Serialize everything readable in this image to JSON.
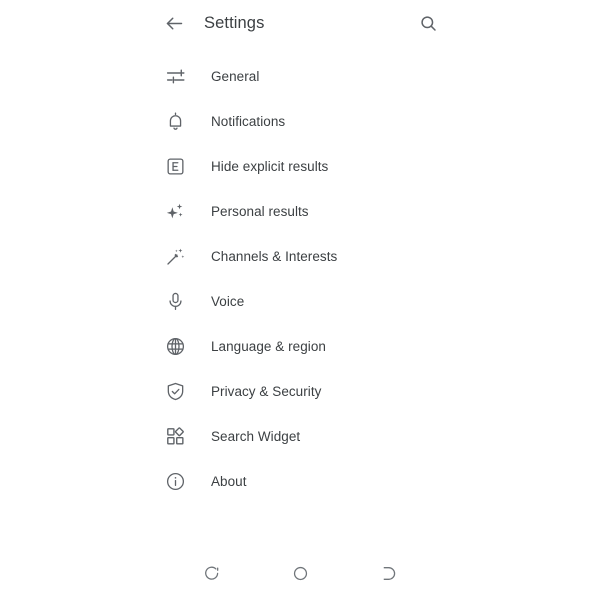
{
  "appbar": {
    "back_icon": "arrow-back-icon",
    "title": "Settings",
    "search_icon": "search-icon"
  },
  "colors": {
    "background": "#ffffff",
    "text": "#3c4043",
    "icon": "#5f6368",
    "nav_icon": "#70757a"
  },
  "settings": {
    "items": [
      {
        "label": "General",
        "icon": "tune-icon"
      },
      {
        "label": "Notifications",
        "icon": "bell-icon"
      },
      {
        "label": "Hide explicit results",
        "icon": "explicit-icon"
      },
      {
        "label": "Personal results",
        "icon": "sparkle-icon"
      },
      {
        "label": "Channels & Interests",
        "icon": "magic-wand-icon"
      },
      {
        "label": "Voice",
        "icon": "microphone-icon"
      },
      {
        "label": "Language & region",
        "icon": "globe-icon"
      },
      {
        "label": "Privacy & Security",
        "icon": "shield-check-icon"
      },
      {
        "label": "Search Widget",
        "icon": "widgets-icon"
      },
      {
        "label": "About",
        "icon": "info-circle-icon"
      }
    ]
  },
  "navbar": {
    "back": "nav-back-icon",
    "home": "nav-home-icon",
    "recents": "nav-recents-icon"
  }
}
